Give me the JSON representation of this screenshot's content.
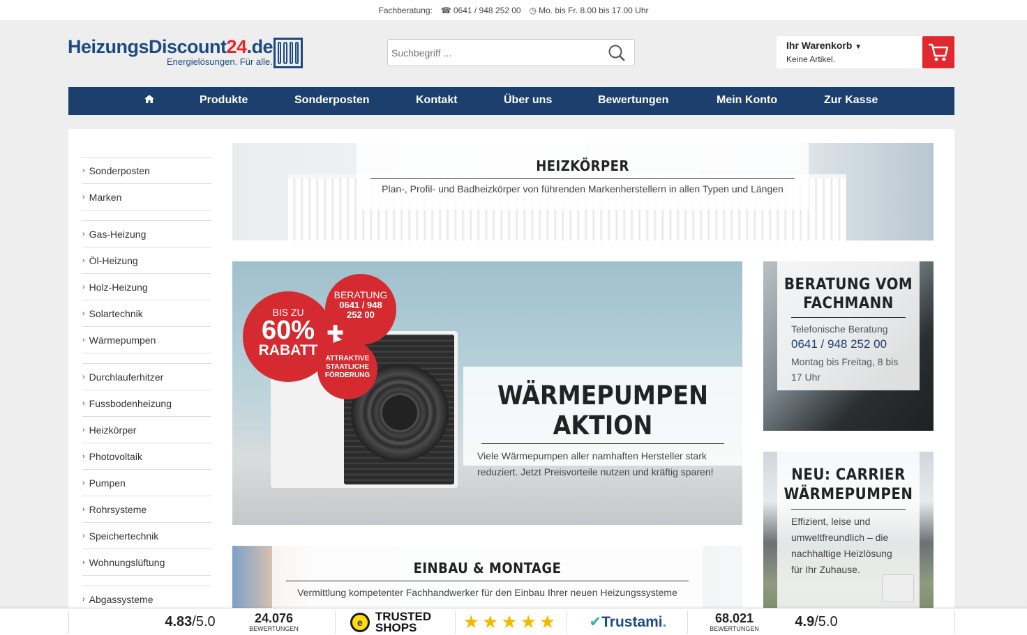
{
  "topbar": {
    "label": "Fachberatung:",
    "phone": "0641 / 948 252 00",
    "hours": "Mo. bis Fr. 8.00 bis 17.00 Uhr"
  },
  "logo": {
    "brand_main": "HeizungsDiscount",
    "brand_num": "24",
    "brand_tld": ".de",
    "tagline": "Energielösungen. Für alle."
  },
  "search": {
    "placeholder": "Suchbegriff ..."
  },
  "cart": {
    "title": "Ihr Warenkorb",
    "status": "Keine Artikel."
  },
  "nav": {
    "items": [
      "Produkte",
      "Sonderposten",
      "Kontakt",
      "Über uns",
      "Bewertungen",
      "Mein Konto",
      "Zur Kasse"
    ]
  },
  "sidebar": {
    "groups": [
      [
        "Sonderposten",
        "Marken"
      ],
      [
        "Gas-Heizung",
        "Öl-Heizung",
        "Holz-Heizung",
        "Solartechnik",
        "Wärmepumpen"
      ],
      [
        "Durchlauferhitzer",
        "Fussbodenheizung",
        "Heizkörper",
        "Photovoltaik",
        "Pumpen",
        "Rohrsysteme",
        "Speichertechnik",
        "Wohnungslüftung"
      ],
      [
        "Abgassysteme"
      ]
    ]
  },
  "banners": {
    "heizkoerper": {
      "title": "HEIZKÖRPER",
      "desc": "Plan-, Profil- und Badheizkörper von führenden Markenherstellern in allen Typen und Längen"
    },
    "waermepumpen": {
      "title": "WÄRMEPUMPEN AKTION",
      "desc": "Viele Wärmepumpen aller namhaften Hersteller stark reduziert. Jetzt Preisvorteile nutzen und kräftig sparen!",
      "badge_rabatt": {
        "pre": "BIS ZU",
        "value": "60%",
        "post": "RABATT"
      },
      "badge_beratung": {
        "pre": "BERATUNG",
        "line1": "0641 / 948",
        "line2": "252 00"
      },
      "badge_foerderung": {
        "line1": "ATTRAKTIVE",
        "line2": "STAATLICHE",
        "line3": "FÖRDERUNG"
      }
    },
    "beratung": {
      "title_1": "BERATUNG VOM",
      "title_2": "FACHMANN",
      "label": "Telefonische Beratung",
      "phone": "0641 / 948 252 00",
      "hours": "Montag bis Freitag, 8 bis 17 Uhr"
    },
    "carrier": {
      "title_1": "NEU: CARRIER",
      "title_2": "WÄRMEPUMPEN",
      "desc": "Effizient, leise und umweltfreundlich – die nachhaltige Heizlösung für Ihr Zuhause."
    },
    "einbau": {
      "title": "EINBAU & MONTAGE",
      "desc": "Vermittlung kompetenter Fachhandwerker für den Einbau Ihrer neuen Heizungssysteme"
    }
  },
  "footer": {
    "rating_left": {
      "value": "4.83",
      "scale": "/5.0"
    },
    "count_left": {
      "value": "24.076",
      "label": "BEWERTUNGEN"
    },
    "trusted_shops": {
      "line1": "TRUSTED",
      "line2": "SHOPS",
      "badge": "e"
    },
    "stars": "★★★★★",
    "trustami": {
      "prefix": "Trustami",
      "suffix": "."
    },
    "count_right": {
      "value": "68.021",
      "label": "BEWERTUNGEN"
    },
    "rating_right": {
      "value": "4.9",
      "scale": "/5.0"
    }
  },
  "colors": {
    "brand_blue": "#1c3f6e",
    "accent_red": "#e0282e",
    "star_yellow": "#f5b800"
  }
}
